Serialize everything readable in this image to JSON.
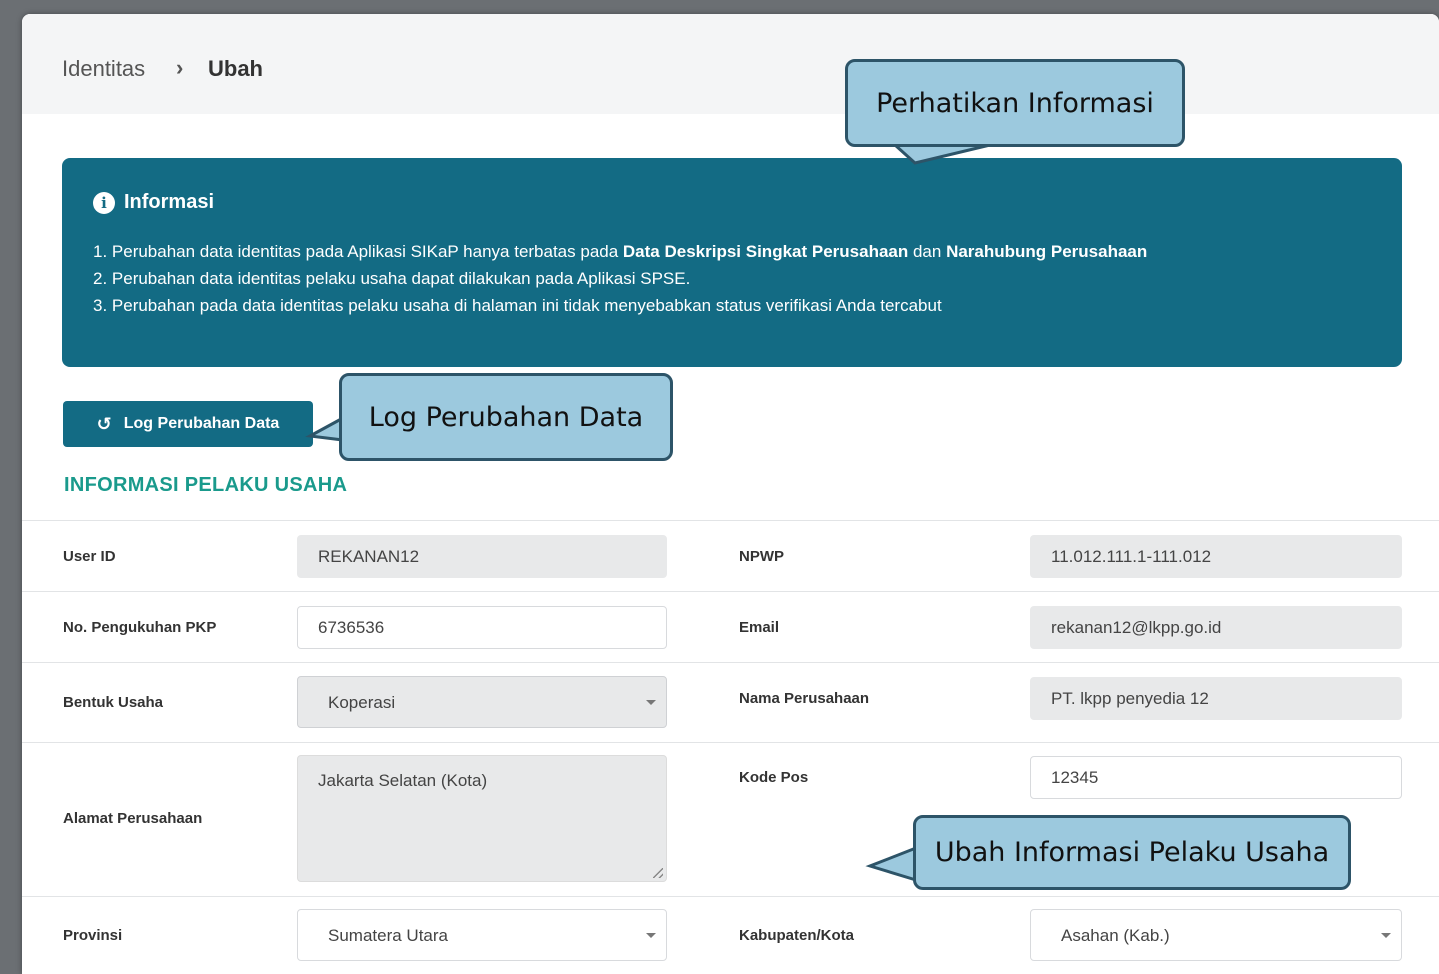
{
  "breadcrumb": {
    "home": "Identitas",
    "separator": "›",
    "current": "Ubah"
  },
  "info": {
    "title": "Informasi",
    "lines": [
      {
        "pre": "1. Perubahan data identitas pada Aplikasi SIKaP hanya terbatas pada ",
        "b1": "Data Deskripsi Singkat Perusahaan",
        "mid": " dan ",
        "b2": "Narahubung Perusahaan"
      },
      {
        "text": "2. Perubahan data identitas pelaku usaha dapat dilakukan pada Aplikasi SPSE."
      },
      {
        "text": "3. Perubahan pada data identitas pelaku usaha di halaman ini tidak menyebabkan status verifikasi Anda tercabut"
      }
    ]
  },
  "log_button": {
    "icon": "history-icon",
    "label": "Log Perubahan Data"
  },
  "section_title": "INFORMASI PELAKU USAHA",
  "form": {
    "user_id": {
      "label": "User ID",
      "value": "REKANAN12"
    },
    "npwp": {
      "label": "NPWP",
      "value": "11.012.111.1-111.012"
    },
    "pkp": {
      "label": "No. Pengukuhan PKP",
      "value": "6736536"
    },
    "email": {
      "label": "Email",
      "value": "rekanan12@lkpp.go.id"
    },
    "bentuk_usaha": {
      "label": "Bentuk Usaha",
      "value": "Koperasi"
    },
    "nama_perusahaan": {
      "label": "Nama Perusahaan",
      "value": "PT. lkpp penyedia 12"
    },
    "alamat": {
      "label": "Alamat Perusahaan",
      "value": "Jakarta Selatan (Kota)"
    },
    "kode_pos": {
      "label": "Kode Pos",
      "value": "12345"
    },
    "provinsi": {
      "label": "Provinsi",
      "value": "Sumatera Utara"
    },
    "kabupaten": {
      "label": "Kabupaten/Kota",
      "value": "Asahan (Kab.)"
    }
  },
  "callouts": {
    "perhatikan": "Perhatikan Informasi",
    "log": "Log Perubahan Data",
    "ubah": "Ubah Informasi Pelaku Usaha"
  },
  "colors": {
    "primary": "#136b84",
    "section": "#1a9a8c",
    "callout_bg": "#9cc9de",
    "callout_border": "#2d5468"
  }
}
